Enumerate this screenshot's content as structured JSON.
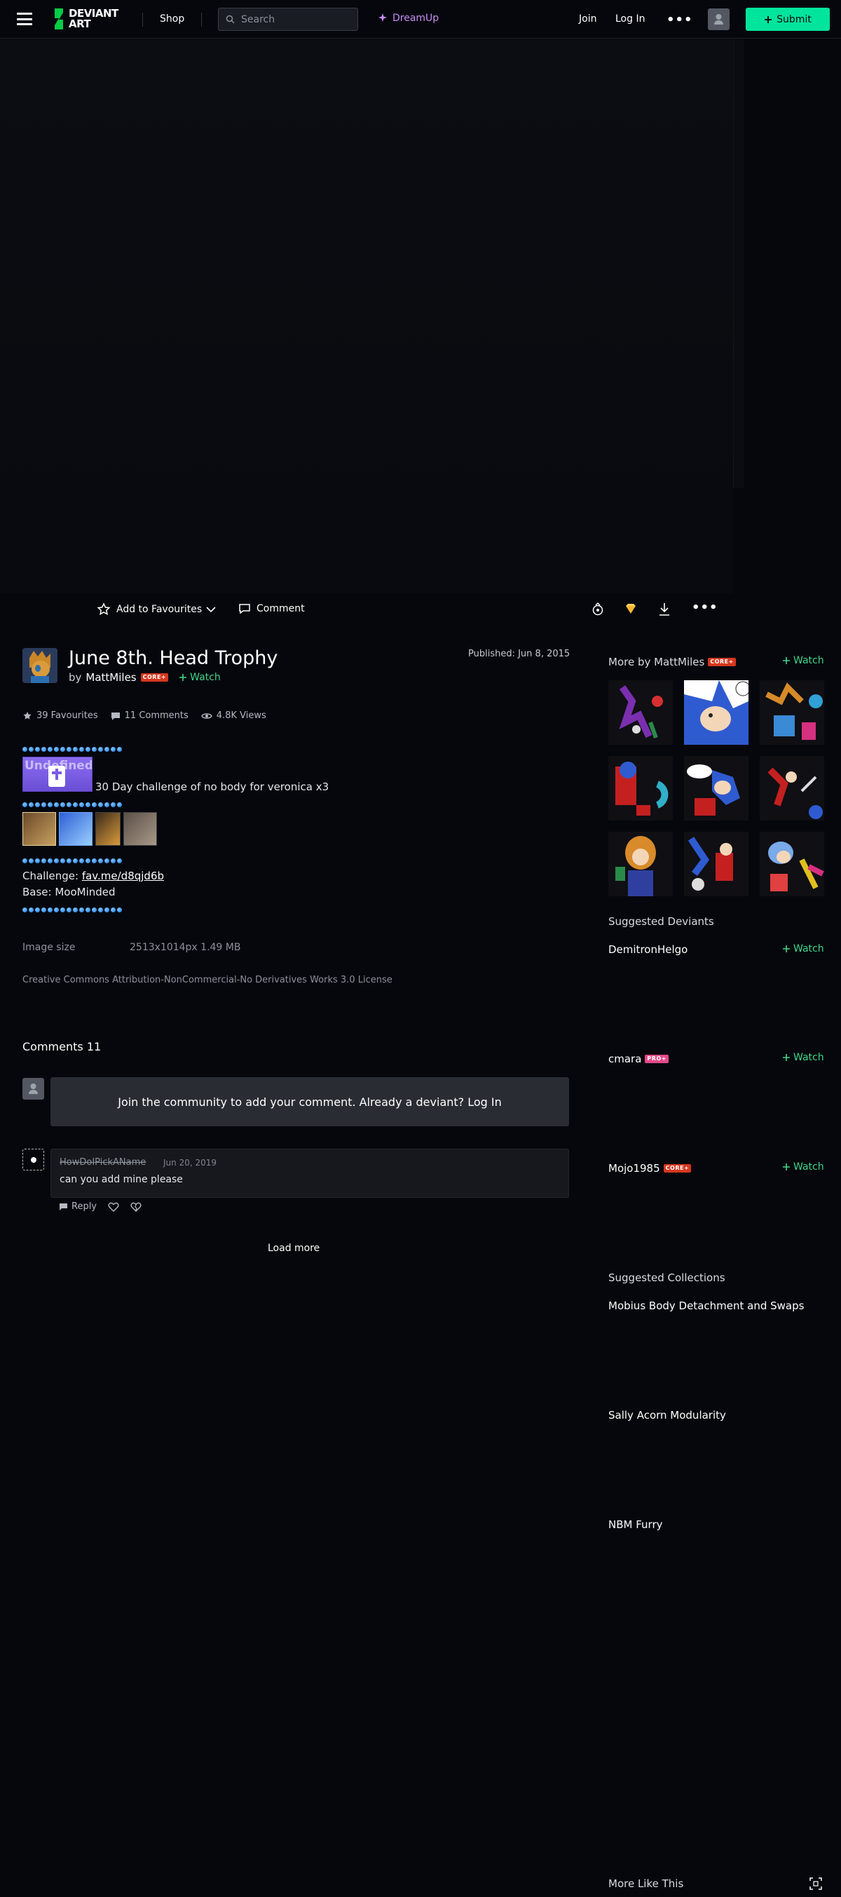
{
  "header": {
    "logo_text_1": "DEVIANT",
    "logo_text_2": "ART",
    "shop_label": "Shop",
    "search_placeholder": "Search",
    "dreamup_label": "DreamUp",
    "join_label": "Join",
    "login_label": "Log In",
    "more_label": "•••",
    "submit_label": "Submit"
  },
  "actions": {
    "favourite_label": "Add to Favourites",
    "comment_label": "Comment"
  },
  "deviation": {
    "title": "June 8th. Head Trophy",
    "by_prefix": "by",
    "author": "MattMiles",
    "author_badge": "CORE+",
    "watch_label": "Watch",
    "published": "Published: Jun 8, 2015",
    "favourites": "39 Favourites",
    "comments": "11 Comments",
    "views": "4.8K Views"
  },
  "description": {
    "stamp_text_1": "Undefined",
    "stamp_text_2": "n",
    "line1": "30 Day challenge of no body for veronica x3",
    "challenge_label": "Challenge:",
    "challenge_link": "fav.me/d8qjd6b",
    "base": "Base: MooMinded"
  },
  "image_info": {
    "size_label": "Image size",
    "size_value": "2513x1014px 1.49 MB",
    "license": "Creative Commons Attribution-NonCommercial-No Derivatives Works 3.0 License"
  },
  "comments": {
    "title": "Comments 11",
    "join_prompt": "Join the community to add your comment. Already a deviant? Log In",
    "items": [
      {
        "user": "HowDoIPickAName",
        "date": "Jun 20, 2019",
        "text": "can you add mine please",
        "reply_label": "Reply"
      }
    ],
    "load_more": "Load more"
  },
  "sidebar": {
    "more_by_prefix": "More by MattMiles",
    "more_by_badge": "CORE+",
    "watch_label": "Watch",
    "suggested_deviants_title": "Suggested Deviants",
    "suggested_deviants": [
      {
        "name": "DemitronHelgo",
        "badge": ""
      },
      {
        "name": "cmara",
        "badge": "PRO+"
      },
      {
        "name": "Mojo1985",
        "badge": "CORE+"
      }
    ],
    "suggested_collections_title": "Suggested Collections",
    "collections": [
      "Mobius Body Detachment and Swaps",
      "Sally Acorn Modularity",
      "NBM Furry"
    ],
    "more_like_this": "More Like This"
  },
  "colors": {
    "accent_green": "#00e59b",
    "watch_green": "#40d68a",
    "dreamup_purple": "#c78df4",
    "background": "#06070d"
  }
}
